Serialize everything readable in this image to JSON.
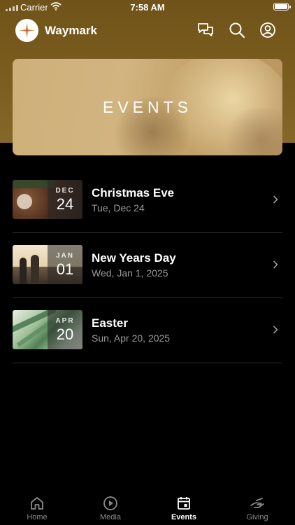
{
  "status_bar": {
    "carrier": "Carrier",
    "time": "7:58 AM"
  },
  "header": {
    "app_name": "Waymark"
  },
  "hero": {
    "title": "EVENTS"
  },
  "events": [
    {
      "title": "Christmas Eve",
      "date": "Tue, Dec 24",
      "month": "DEC",
      "day": "24"
    },
    {
      "title": "New Years Day",
      "date": "Wed, Jan 1, 2025",
      "month": "JAN",
      "day": "01"
    },
    {
      "title": "Easter",
      "date": "Sun, Apr 20, 2025",
      "month": "APR",
      "day": "20"
    }
  ],
  "tabs": [
    {
      "label": "Home",
      "icon": "home-icon"
    },
    {
      "label": "Media",
      "icon": "play-icon"
    },
    {
      "label": "Events",
      "icon": "calendar-icon",
      "active": true
    },
    {
      "label": "Giving",
      "icon": "giving-icon"
    }
  ],
  "colors": {
    "header_gold": "#7a5c1e",
    "background": "#000000",
    "muted_text": "#9a9a9a"
  }
}
